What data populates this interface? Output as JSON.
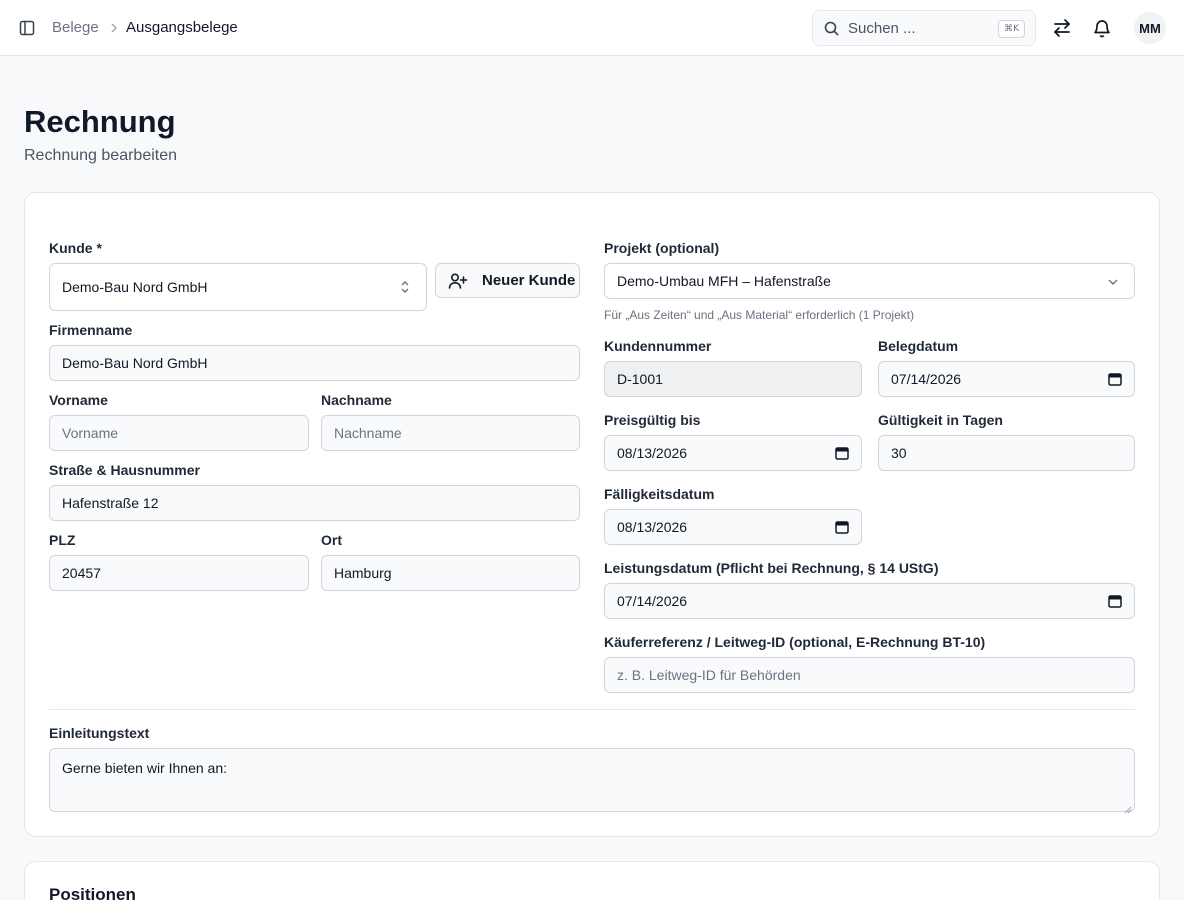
{
  "header": {
    "breadcrumb": [
      "Belege",
      "Ausgangsbelege"
    ],
    "search_placeholder": "Suchen ...",
    "search_shortcut": "⌘K",
    "avatar_initials": "MM"
  },
  "page": {
    "title": "Rechnung",
    "subtitle": "Rechnung bearbeiten"
  },
  "form": {
    "customer": {
      "label": "Kunde *",
      "value": "Demo-Bau Nord GmbH",
      "new_button": "Neuer Kunde"
    },
    "company": {
      "label": "Firmenname",
      "value": "Demo-Bau Nord GmbH"
    },
    "first_name": {
      "label": "Vorname",
      "placeholder": "Vorname"
    },
    "last_name": {
      "label": "Nachname",
      "placeholder": "Nachname"
    },
    "street": {
      "label": "Straße & Hausnummer",
      "value": "Hafenstraße 12"
    },
    "zip": {
      "label": "PLZ",
      "value": "20457"
    },
    "city": {
      "label": "Ort",
      "value": "Hamburg"
    },
    "project": {
      "label": "Projekt (optional)",
      "value": "Demo-Umbau MFH – Hafenstraße",
      "hint": "Für „Aus Zeiten“ und „Aus Material“ erforderlich (1 Projekt)"
    },
    "customer_number": {
      "label": "Kundennummer",
      "value": "D-1001"
    },
    "document_date": {
      "label": "Belegdatum",
      "value": "07/14/2026"
    },
    "valid_until": {
      "label": "Preisgültig bis",
      "value": "08/13/2026"
    },
    "validity_days": {
      "label": "Gültigkeit in Tagen",
      "value": "30"
    },
    "due_date": {
      "label": "Fälligkeitsdatum",
      "value": "08/13/2026"
    },
    "service_date": {
      "label": "Leistungsdatum (Pflicht bei Rechnung, § 14 UStG)",
      "value": "07/14/2026"
    },
    "buyer_reference": {
      "label": "Käuferreferenz / Leitweg-ID (optional, E-Rechnung BT-10)",
      "placeholder": "z. B. Leitweg-ID für Behörden"
    },
    "intro_text": {
      "label": "Einleitungstext",
      "value": "Gerne bieten wir Ihnen an:"
    }
  },
  "positions": {
    "title": "Positionen"
  },
  "colors": {
    "border": "#d1d5db",
    "input_bg": "#f9fafb",
    "readonly_bg": "#eef0f2",
    "text": "#111827",
    "muted": "#6b7280"
  },
  "icons": [
    "sidebar-toggle-icon",
    "chevron-right-icon",
    "search-icon",
    "swap-icon",
    "bell-icon",
    "user-plus-icon",
    "chevron-up-down-icon",
    "chevron-down-icon",
    "calendar-icon"
  ]
}
